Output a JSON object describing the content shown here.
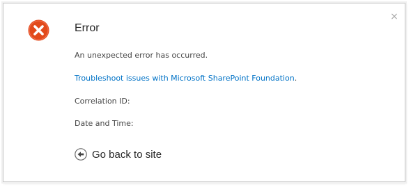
{
  "dialog": {
    "title": "Error",
    "close_glyph": "×",
    "icon": "error-x-circle",
    "message": "An unexpected error has occurred.",
    "link_text": "Troubleshoot issues with Microsoft SharePoint Foundation",
    "link_suffix": ".",
    "correlation_label": "Correlation ID:",
    "date_label": "Date and Time:",
    "go_back_label": "Go back to site"
  },
  "colors": {
    "error_icon": "#e24a1b",
    "link": "#0072c6",
    "title": "#262626",
    "body_text": "#444444",
    "close": "#a8a8a8"
  }
}
